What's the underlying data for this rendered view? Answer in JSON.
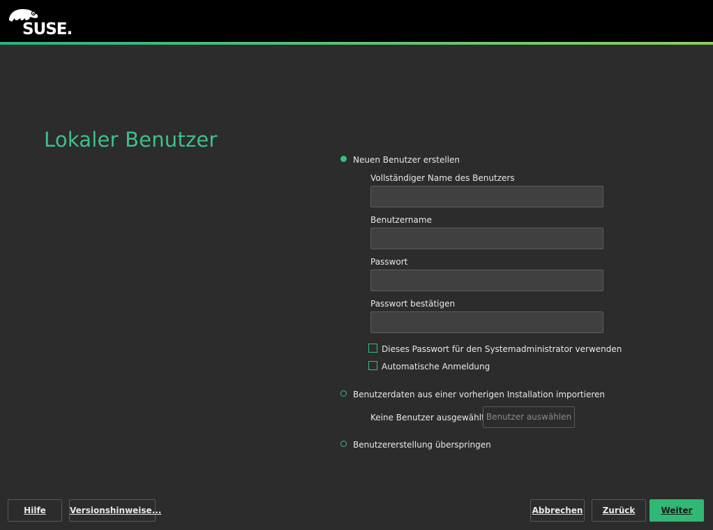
{
  "brand": {
    "logo_text": "SUSE.",
    "accent_color": "#3fbf8a",
    "primary_button_color": "#30b874"
  },
  "page": {
    "title": "Lokaler Benutzer"
  },
  "options": {
    "create_new": {
      "label": "Neuen Benutzer erstellen",
      "selected": true
    },
    "import": {
      "label": "Benutzerdaten aus einer vorherigen Installation importieren",
      "selected": false
    },
    "skip": {
      "label": "Benutzererstellung überspringen",
      "selected": false
    }
  },
  "form": {
    "fullname": {
      "label": "Vollständiger Name des Benutzers",
      "value": ""
    },
    "username": {
      "label": "Benutzername",
      "value": ""
    },
    "password": {
      "label": "Passwort",
      "value": ""
    },
    "password_confirm": {
      "label": "Passwort bestätigen",
      "value": ""
    },
    "use_for_admin": {
      "label": "Dieses Passwort für den Systemadministrator verwenden",
      "checked": false
    },
    "autologin": {
      "label": "Automatische Anmeldung",
      "checked": false
    }
  },
  "import": {
    "status": "Keine Benutzer ausgewählt",
    "select_button": "Benutzer auswählen"
  },
  "footer": {
    "help": "Hilfe",
    "release_notes": "Versionshinweise...",
    "abort": "Abbrechen",
    "back": "Zurück",
    "next": "Weiter"
  }
}
